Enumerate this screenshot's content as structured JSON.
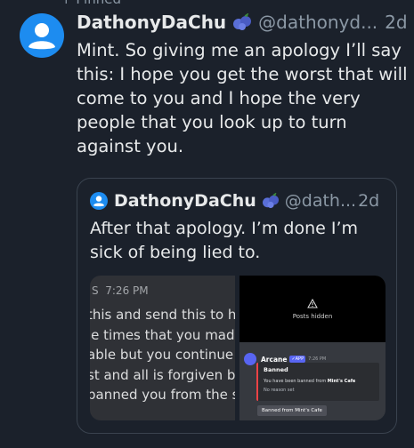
{
  "pinned_label": "Pinned",
  "post": {
    "author_name": "DathonyDaChu",
    "author_handle": "@dathonyd...",
    "timestamp": "2d",
    "text": "Mint. So giving me an apology I’ll say this: I hope you get the worst that will come to you and I hope the very people that you look up to turn against you.",
    "avatar_icon": "default-user-avatar-icon",
    "badge_icon": "blueberries-icon"
  },
  "quote": {
    "author_name": "DathonyDaChu",
    "author_handle": "@dath...",
    "timestamp": "2d",
    "text": "After that apology. I’m done I’m sick of being lied to.",
    "media_left": {
      "time": "7:26 PM",
      "lines": [
        "this and send this to h",
        "le times that you made",
        "able but you continue t",
        "st and all is forgiven bu",
        "banned you from the s"
      ]
    },
    "media_right": {
      "hidden_label": "Posts hidden",
      "bot_name": "Arcane",
      "app_tag": "APP",
      "bot_time": "7:26 PM",
      "embed_title": "Banned",
      "embed_desc_prefix": "You have been banned from",
      "embed_server": "Mint's Cafe",
      "embed_reason": "No reason set",
      "button_label": "Banned from Mint's Cafe"
    }
  },
  "colors": {
    "background": "#1b212b",
    "accent_blue": "#1d8cf0",
    "muted_text": "#8b98a5",
    "embed_red": "#ed4245"
  }
}
